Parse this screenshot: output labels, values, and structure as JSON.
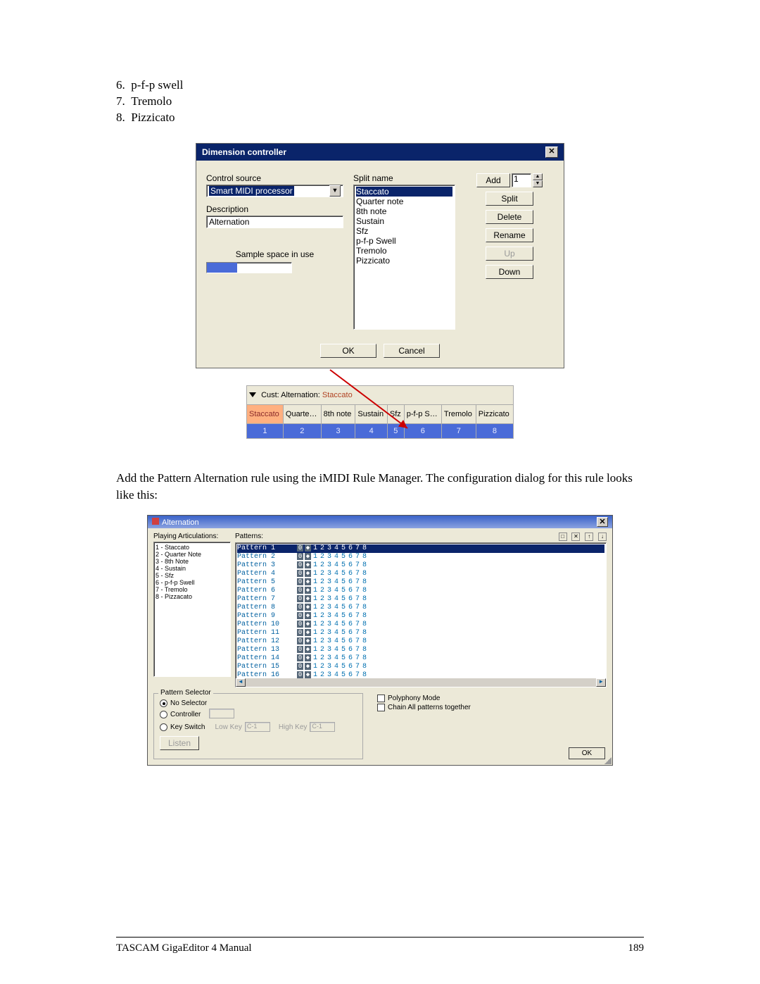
{
  "list_start": 6,
  "ol": [
    "p-f-p swell",
    "Tremolo",
    "Pizzicato"
  ],
  "dlg1": {
    "title": "Dimension controller",
    "control_source_label": "Control source",
    "control_source_value": "Smart MIDI processor",
    "description_label": "Description",
    "description_value": "Alternation",
    "sample_space_label": "Sample space in use",
    "split_name_label": "Split name",
    "split_items": [
      "Staccato",
      "Quarter note",
      "8th note",
      "Sustain",
      "Sfz",
      "p-f-p Swell",
      "Tremolo",
      "Pizzicato"
    ],
    "add": "Add",
    "split": "Split",
    "delete": "Delete",
    "rename": "Rename",
    "up": "Up",
    "down": "Down",
    "spin_value": "1",
    "ok": "OK",
    "cancel": "Cancel"
  },
  "cust": {
    "title_prefix": "Cust: Alternation: ",
    "title_sel": "Staccato",
    "cols": [
      "Staccato",
      "Quarte…",
      "8th note",
      "Sustain",
      "Sfz",
      "p-f-p S…",
      "Tremolo",
      "Pizzicato"
    ],
    "idx": [
      "1",
      "2",
      "3",
      "4",
      "5",
      "6",
      "7",
      "8"
    ]
  },
  "para": "Add the Pattern Alternation rule using the iMIDI Rule Manager. The configuration dialog for this rule looks like this:",
  "dlg2": {
    "title": "Alternation",
    "playing_label": "Playing Articulations:",
    "articulations": [
      "1 - Staccato",
      "2 - Quarter Note",
      "3 - 8th Note",
      "4 - Sustain",
      "5 - Sfz",
      "6 - p-f-p Swell",
      "7 - Tremolo",
      "8 - Pizzacato"
    ],
    "patterns_label": "Patterns:",
    "pattern_count": 16,
    "step_nums": [
      "1",
      "2",
      "3",
      "4",
      "5",
      "6",
      "7",
      "8"
    ],
    "pattern_selector": {
      "legend": "Pattern Selector",
      "no_selector": "No Selector",
      "controller": "Controller",
      "key_switch": "Key Switch",
      "low_key": "Low Key",
      "high_key": "High Key",
      "key_val": "C-1",
      "listen": "Listen"
    },
    "poly": "Polyphony Mode",
    "chain": "Chain All patterns together",
    "ok": "OK"
  },
  "footer_left": "TASCAM GigaEditor 4 Manual",
  "footer_right": "189"
}
